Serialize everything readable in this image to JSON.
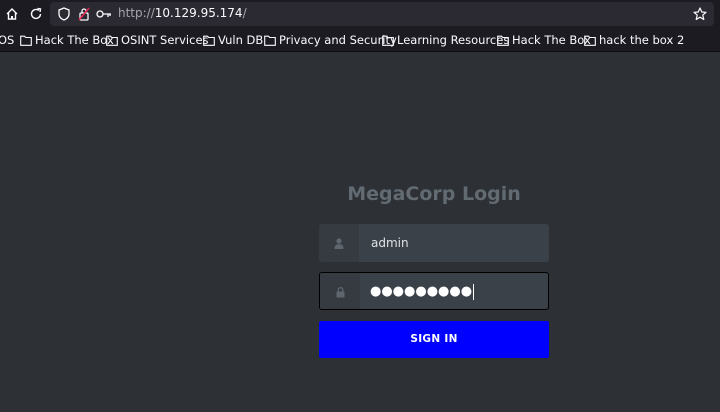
{
  "browser": {
    "url_scheme": "http://",
    "url_host": "10.129.95.174",
    "url_path": "/"
  },
  "bookmarks": [
    {
      "label": "OS"
    },
    {
      "label": "Hack The Box"
    },
    {
      "label": "OSINT Services"
    },
    {
      "label": "Vuln DB"
    },
    {
      "label": "Privacy and Security"
    },
    {
      "label": "Learning Resources"
    },
    {
      "label": "Hack The Box"
    },
    {
      "label": "hack the box 2"
    }
  ],
  "login": {
    "title": "MegaCorp Login",
    "username_value": "admin",
    "password_value": "●●●●●●●●●",
    "signin_label": "SIGN IN"
  },
  "colors": {
    "page_bg": "#2d3035",
    "signin_button": "#0000fe",
    "field_bg": "#3b4148"
  }
}
